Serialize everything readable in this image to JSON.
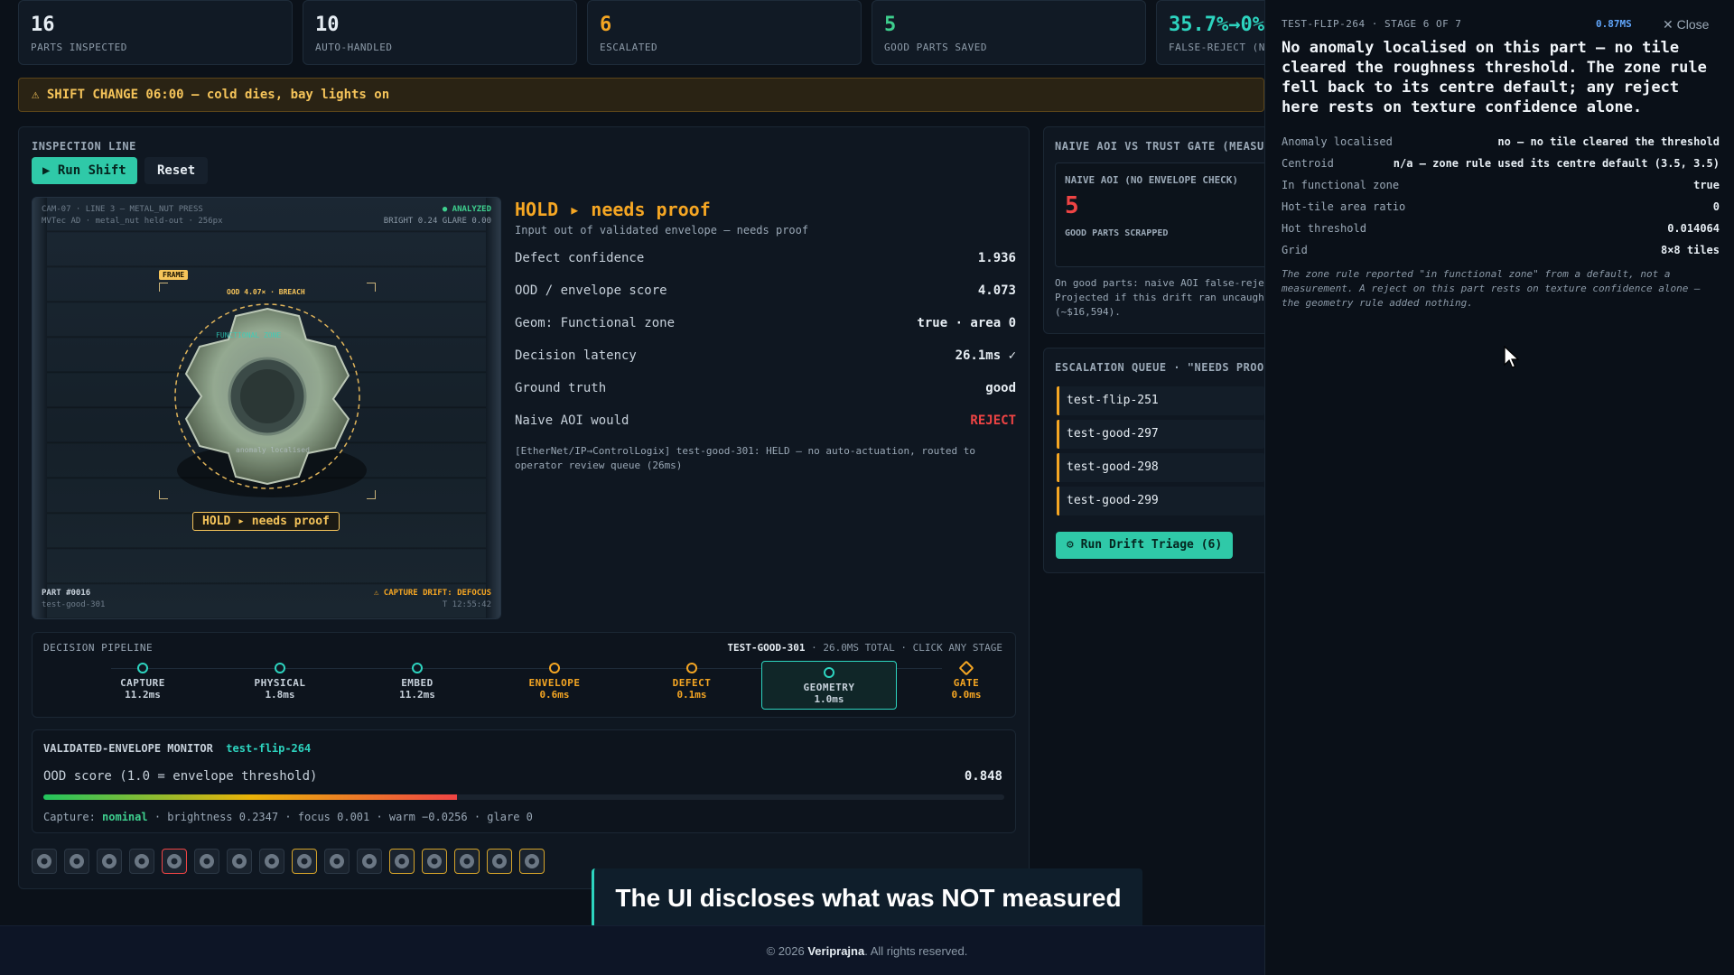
{
  "kpis": [
    {
      "value": "16",
      "label": "PARTS INSPECTED",
      "color": "#e6edf3"
    },
    {
      "value": "10",
      "label": "AUTO-HANDLED",
      "color": "#e6edf3"
    },
    {
      "value": "6",
      "label": "ESCALATED",
      "color": "#f5a623"
    },
    {
      "value": "5",
      "label": "GOOD PARTS SAVED",
      "color": "#3ecf8e"
    },
    {
      "value": "35.7%→0%",
      "label": "FALSE-REJECT (N",
      "color": "#2dd4bf"
    }
  ],
  "banner": {
    "text": "⚠ SHIFT CHANGE 06:00 — cold dies, bay lights on"
  },
  "inspection": {
    "title": "INSPECTION LINE",
    "run_label": "▶ Run Shift",
    "reset_label": "Reset",
    "camera": {
      "header_left_1": "CAM-07 · LINE 3 — METAL_NUT PRESS",
      "header_left_2": "MVTec AD · metal_nut held-out · 256px",
      "analyzed": "● ANALYZED",
      "bright_glare": "BRIGHT 0.24  GLARE 0.00",
      "frame_tag": "FRAME",
      "ood_tag": "OOD 4.07× · BREACH",
      "zone_tag": "FUNCTIONAL ZONE",
      "anomaly_tag": "anomaly localised",
      "hold_badge": "HOLD ▸ needs proof",
      "part_no": "PART #0016",
      "part_id": "test-good-301",
      "drift": "⚠ CAPTURE DRIFT: DEFOCUS",
      "time": "T 12:55:42"
    }
  },
  "decision": {
    "heading": "HOLD ▸ needs proof",
    "sub": "Input out of validated envelope — needs proof",
    "rows": [
      {
        "label": "Defect confidence",
        "value": "1.936"
      },
      {
        "label": "OOD / envelope score",
        "value": "4.073"
      },
      {
        "label": "Geom: Functional zone",
        "value": "true · area 0"
      },
      {
        "label": "Decision latency",
        "value": "26.1ms ✓"
      },
      {
        "label": "Ground truth",
        "value": "good"
      },
      {
        "label": "Naive AOI would",
        "value": "REJECT"
      }
    ],
    "log": "[EtherNet/IP→ControlLogix] test-good-301: HELD — no auto-actuation, routed to operator review queue (26ms)"
  },
  "pipeline": {
    "title": "DECISION PIPELINE",
    "summary_id": "TEST-GOOD-301",
    "summary_rest": " · 26.0MS TOTAL · CLICK ANY STAGE",
    "stages": [
      {
        "name": "CAPTURE",
        "ms": "11.2ms"
      },
      {
        "name": "PHYSICAL",
        "ms": "1.8ms"
      },
      {
        "name": "EMBED",
        "ms": "11.2ms"
      },
      {
        "name": "ENVELOPE",
        "ms": "0.6ms"
      },
      {
        "name": "DEFECT",
        "ms": "0.1ms"
      },
      {
        "name": "GEOMETRY",
        "ms": "1.0ms"
      },
      {
        "name": "GATE",
        "ms": "0.0ms"
      }
    ]
  },
  "envelope": {
    "title": "VALIDATED-ENVELOPE MONITOR",
    "part": "test-flip-264",
    "ood_label": "OOD score (1.0 = envelope threshold)",
    "ood_value": "0.848",
    "ood_fraction": 0.43,
    "capture_prefix": "Capture: ",
    "capture_state": "nominal",
    "capture_rest": " · brightness 0.2347 · focus 0.001 · warm −0.0256 · glare 0"
  },
  "naive": {
    "title": "NAIVE AOI VS TRUST GATE (MEASU",
    "box_title": "NAIVE AOI (NO ENVELOPE CHECK)",
    "box_value": "5",
    "box_label": "GOOD PARTS SCRAPPED",
    "note_1": "On good parts: naive AOI false-reje",
    "note_2": "Projected if this drift ran uncaugh",
    "note_3": "(~$16,594)."
  },
  "queue": {
    "title": "ESCALATION QUEUE · \"NEEDS PROO",
    "items": [
      "test-flip-251",
      "test-good-297",
      "test-good-298",
      "test-good-299"
    ],
    "triage_label": "⚙ Run Drift Triage (6)"
  },
  "side": {
    "stage_label": "TEST-FLIP-264 · STAGE 6 OF 7",
    "time": "0.87MS",
    "close": "✕ Close",
    "heading": "No anomaly localised on this part — no tile cleared the roughness threshold. The zone rule fell back to its centre default; any reject here rests on texture confidence alone.",
    "rows": [
      {
        "k": "Anomaly localised",
        "v": "no — no tile cleared the threshold"
      },
      {
        "k": "Centroid",
        "v": "n/a — zone rule used its centre default (3.5, 3.5)"
      },
      {
        "k": "In functional zone",
        "v": "true"
      },
      {
        "k": "Hot-tile area ratio",
        "v": "0"
      },
      {
        "k": "Hot threshold",
        "v": "0.014064"
      },
      {
        "k": "Grid",
        "v": "8×8 tiles"
      }
    ],
    "note": "The zone rule reported \"in functional zone\" from a default, not a measurement. A reject on this part rests on texture confidence alone — the geometry rule added nothing."
  },
  "caption": "The UI discloses what was NOT measured",
  "footer": {
    "prefix": "© 2026 ",
    "brand": "Veriprajna",
    "suffix": ". All rights reserved."
  }
}
